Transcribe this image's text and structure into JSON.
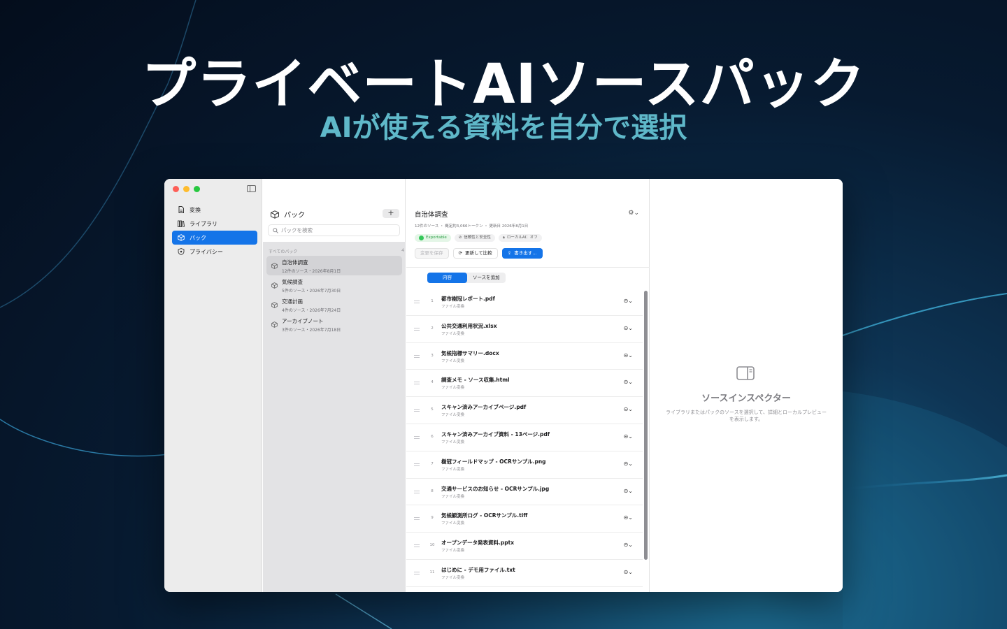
{
  "hero": {
    "title": "プライベートAIソースパック",
    "subtitle": "AIが使える資料を自分で選択"
  },
  "sidebar": {
    "items": [
      {
        "label": "変換",
        "icon": "document-icon",
        "active": false
      },
      {
        "label": "ライブラリ",
        "icon": "library-icon",
        "active": false
      },
      {
        "label": "パック",
        "icon": "cube-icon",
        "active": true
      },
      {
        "label": "プライバシー",
        "icon": "shield-icon",
        "active": false
      }
    ]
  },
  "packs": {
    "title": "パック",
    "add_label": "+",
    "search_placeholder": "パックを検索",
    "section_label": "すべてのパック",
    "section_count": "4",
    "items": [
      {
        "name": "自治体調査",
        "meta": "12件のソース・2026年8月1日",
        "selected": true
      },
      {
        "name": "気候調査",
        "meta": "5件のソース・2026年7月30日",
        "selected": false
      },
      {
        "name": "交通計画",
        "meta": "4件のソース・2026年7月24日",
        "selected": false
      },
      {
        "name": "アーカイブノート",
        "meta": "3件のソース・2026年7月18日",
        "selected": false
      }
    ]
  },
  "detail": {
    "title": "自治体調査",
    "gear": "⚙⌄",
    "meta": "12件のソース ・ 概定約3,066トークン ・ 更新日 2026年8月1日",
    "badges": {
      "exportable": "Exportable",
      "trust": "信頼性と安全性",
      "local_ai": "ローカルAI：オフ"
    },
    "actions": {
      "save": "変更を保存",
      "refresh": "更新して比較",
      "export": "書き出す…"
    },
    "tabs": {
      "content": "内容",
      "add_source": "ソースを追加"
    },
    "rows": [
      {
        "num": "1",
        "name": "都市樹冠レポート.pdf",
        "sub": "ファイル変換"
      },
      {
        "num": "2",
        "name": "公共交通利用状況.xlsx",
        "sub": "ファイル変換"
      },
      {
        "num": "3",
        "name": "気候指標サマリー.docx",
        "sub": "ファイル変換"
      },
      {
        "num": "4",
        "name": "調査メモ - ソース収集.html",
        "sub": "ファイル変換"
      },
      {
        "num": "5",
        "name": "スキャン済みアーカイブページ.pdf",
        "sub": "ファイル変換"
      },
      {
        "num": "6",
        "name": "スキャン済みアーカイブ資料 - 13ページ.pdf",
        "sub": "ファイル変換"
      },
      {
        "num": "7",
        "name": "樹冠フィールドマップ - OCRサンプル.png",
        "sub": "ファイル変換"
      },
      {
        "num": "8",
        "name": "交通サービスのお知らせ - OCRサンプル.jpg",
        "sub": "ファイル変換"
      },
      {
        "num": "9",
        "name": "気候観測所ログ - OCRサンプル.tiff",
        "sub": "ファイル変換"
      },
      {
        "num": "10",
        "name": "オープンデータ発表資料.pptx",
        "sub": "ファイル変換"
      },
      {
        "num": "11",
        "name": "はじめに - デモ用ファイル.txt",
        "sub": "ファイル変換"
      }
    ],
    "row_menu": "⊝⌄"
  },
  "inspector": {
    "title": "ソースインスペクター",
    "description": "ライブラリまたはパックのソースを選択して、詳細とローカルプレビューを表示します。"
  },
  "colors": {
    "accent": "#1474e8",
    "hero_subtitle": "#5fb8c9",
    "exportable": "#2e9e47"
  }
}
